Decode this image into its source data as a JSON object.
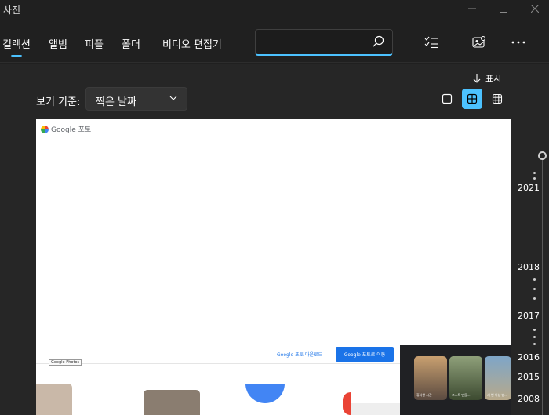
{
  "window": {
    "title": "사진",
    "controls": [
      "minimize",
      "maximize",
      "close"
    ]
  },
  "nav": {
    "items": [
      {
        "label": "컬렉션",
        "active": true
      },
      {
        "label": "앨범",
        "active": false
      },
      {
        "label": "피플",
        "active": false
      },
      {
        "label": "폴더",
        "active": false
      },
      {
        "label": "비디오 편집기",
        "active": false
      }
    ],
    "accent": "#4cc2ff"
  },
  "search": {
    "value": "",
    "placeholder": ""
  },
  "toolbar": {
    "icons": [
      "select-list-icon",
      "import-icon",
      "more-icon"
    ]
  },
  "display": {
    "show_label": "표시"
  },
  "sort": {
    "label": "보기 기준:",
    "selected": "찍은 날짜"
  },
  "view_modes": [
    {
      "name": "single-view",
      "active": false
    },
    {
      "name": "medium-grid-view",
      "active": true
    },
    {
      "name": "small-grid-view",
      "active": false
    }
  ],
  "preview": {
    "logo_text": "Google 포토",
    "tooltip": "Google Photos",
    "download_link": "Google 포토 다운로드",
    "go_button": "Google 포토로 이동",
    "thumb_captions": [
      "휴식한 시간",
      "포스트 만들...",
      "세 번 이상 방..."
    ]
  },
  "timeline": {
    "years": [
      "2021",
      "2018",
      "2017",
      "2016",
      "2015",
      "2008"
    ]
  }
}
